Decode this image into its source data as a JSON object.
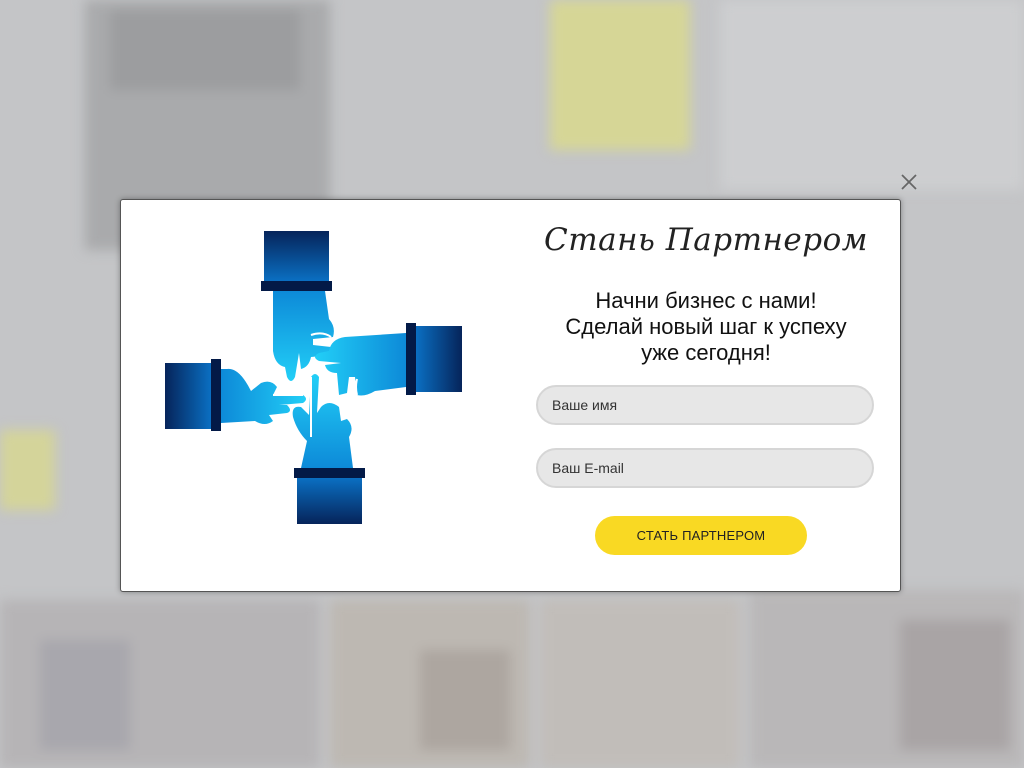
{
  "popup": {
    "title": "Стань Партнером",
    "subtitle_lines": [
      "Начни бизнес с нами!",
      "Сделай новый шаг к успеху",
      "уже сегодня!"
    ],
    "name_placeholder": "Ваше имя",
    "email_placeholder": "Ваш E-mail",
    "submit_label": "СТАТЬ ПАРТНЕРОМ",
    "close_icon": "close-icon",
    "illustration_icon": "four-hands-teamwork-icon"
  },
  "colors": {
    "accent": "#f9d923",
    "hand_light": "#1ec8f5",
    "hand_dark": "#06356f",
    "overlay": "#c4c5c7"
  }
}
